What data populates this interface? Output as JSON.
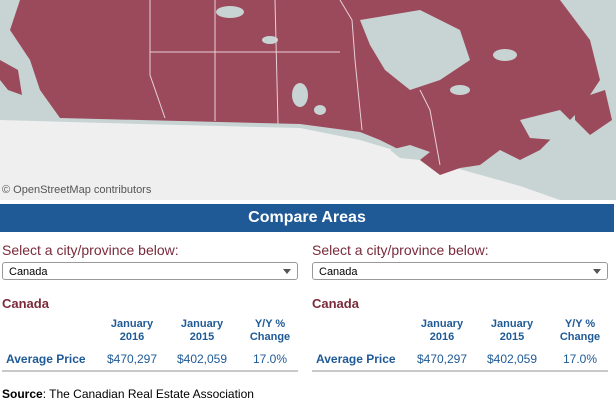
{
  "map": {
    "attribution": "© OpenStreetMap contributors",
    "colors": {
      "land": "#9b4a5b",
      "water": "#c8d4d4",
      "us_land": "#efefef",
      "border": "#e8d0d6"
    }
  },
  "compare": {
    "title": "Compare Areas"
  },
  "colors": {
    "accent_blue": "#1f5a96",
    "label_red": "#7a2a3a"
  },
  "panels": [
    {
      "select_label": "Select a city/province below:",
      "selected": "Canada",
      "area_name": "Canada",
      "headers": {
        "col1": "January\n2016",
        "col2": "January\n2015",
        "col3": "Y/Y %\nChange"
      },
      "row_label": "Average Price",
      "values": {
        "col1": "$470,297",
        "col2": "$402,059",
        "col3": "17.0%"
      }
    },
    {
      "select_label": "Select a city/province below:",
      "selected": "Canada",
      "area_name": "Canada",
      "headers": {
        "col1": "January\n2016",
        "col2": "January\n2015",
        "col3": "Y/Y %\nChange"
      },
      "row_label": "Average Price",
      "values": {
        "col1": "$470,297",
        "col2": "$402,059",
        "col3": "17.0%"
      }
    }
  ],
  "source": {
    "label": "Source",
    "text": ": The Canadian Real Estate Association"
  }
}
